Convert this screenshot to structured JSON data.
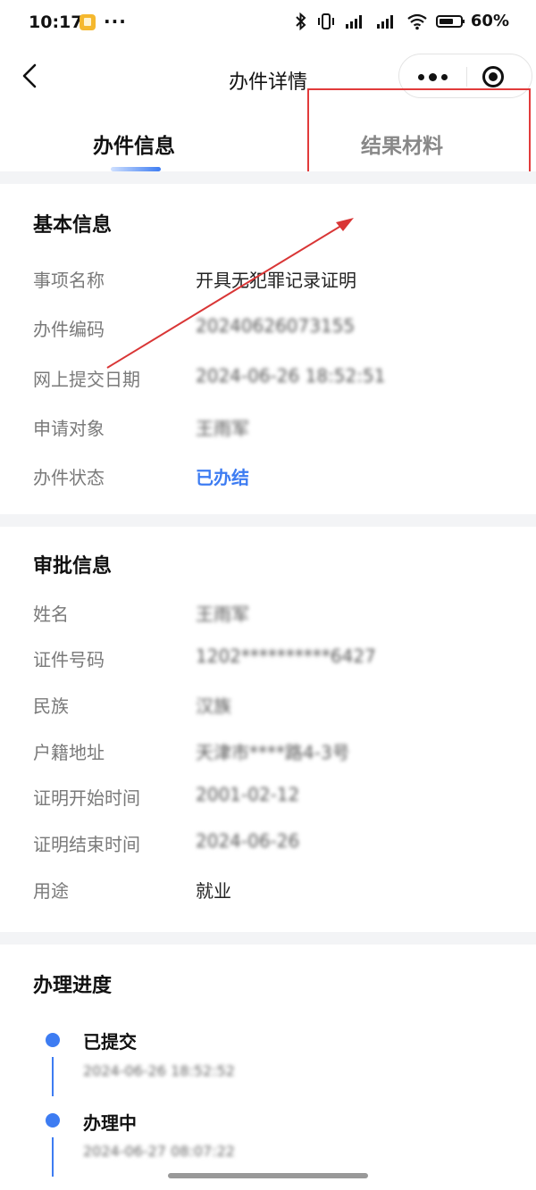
{
  "status_bar": {
    "time": "10:17",
    "more": "···",
    "battery": "60"
  },
  "nav": {
    "title": "办件详情"
  },
  "tabs": [
    {
      "label": "办件信息",
      "active": true
    },
    {
      "label": "结果材料",
      "active": false
    }
  ],
  "basic_info": {
    "title": "基本信息",
    "rows": [
      {
        "label": "事项名称",
        "value": "开具无犯罪记录证明"
      },
      {
        "label": "办件编码",
        "value": "20240626073155"
      },
      {
        "label": "网上提交日期",
        "value": "2024-06-26 18:52:51"
      },
      {
        "label": "申请对象",
        "value": "王雨军"
      },
      {
        "label": "办件状态",
        "value": "已办结"
      }
    ]
  },
  "approval_info": {
    "title": "审批信息",
    "rows": [
      {
        "label": "姓名",
        "value": "王雨军"
      },
      {
        "label": "证件号码",
        "value": "1202**********6427"
      },
      {
        "label": "民族",
        "value": "汉族"
      },
      {
        "label": "户籍地址",
        "value": "天津市****路4-3号"
      },
      {
        "label": "证明开始时间",
        "value": "2001-02-12"
      },
      {
        "label": "证明结束时间",
        "value": "2024-06-26"
      },
      {
        "label": "用途",
        "value": "就业"
      }
    ]
  },
  "progress": {
    "title": "办理进度",
    "steps": [
      {
        "title": "已提交",
        "time": "2024-06-26 18:52:52"
      },
      {
        "title": "办理中",
        "time": "2024-06-27 08:07:22"
      }
    ]
  },
  "colors": {
    "accent": "#3d7cf2",
    "highlight": "#e23b3b",
    "divider": "#f3f4f6"
  }
}
